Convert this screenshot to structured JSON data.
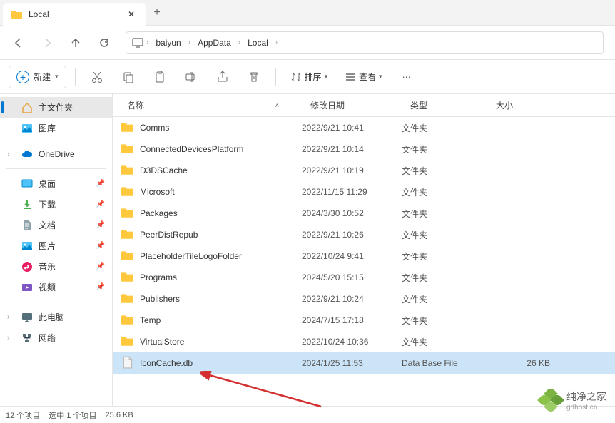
{
  "tab": {
    "title": "Local"
  },
  "breadcrumb": [
    "baiyun",
    "AppData",
    "Local"
  ],
  "toolbar": {
    "new_label": "新建",
    "sort_label": "排序",
    "view_label": "查看"
  },
  "columns": {
    "name": "名称",
    "date": "修改日期",
    "type": "类型",
    "size": "大小"
  },
  "sidebar": {
    "home": "主文件夹",
    "gallery": "图库",
    "onedrive": "OneDrive",
    "desktop": "桌面",
    "downloads": "下载",
    "documents": "文档",
    "pictures": "图片",
    "music": "音乐",
    "videos": "视频",
    "thispc": "此电脑",
    "network": "网络"
  },
  "files": [
    {
      "name": "Comms",
      "date": "2022/9/21 10:41",
      "type": "文件夹",
      "size": "",
      "kind": "folder"
    },
    {
      "name": "ConnectedDevicesPlatform",
      "date": "2022/9/21 10:14",
      "type": "文件夹",
      "size": "",
      "kind": "folder"
    },
    {
      "name": "D3DSCache",
      "date": "2022/9/21 10:19",
      "type": "文件夹",
      "size": "",
      "kind": "folder"
    },
    {
      "name": "Microsoft",
      "date": "2022/11/15 11:29",
      "type": "文件夹",
      "size": "",
      "kind": "folder"
    },
    {
      "name": "Packages",
      "date": "2024/3/30 10:52",
      "type": "文件夹",
      "size": "",
      "kind": "folder"
    },
    {
      "name": "PeerDistRepub",
      "date": "2022/9/21 10:26",
      "type": "文件夹",
      "size": "",
      "kind": "folder"
    },
    {
      "name": "PlaceholderTileLogoFolder",
      "date": "2022/10/24 9:41",
      "type": "文件夹",
      "size": "",
      "kind": "folder"
    },
    {
      "name": "Programs",
      "date": "2024/5/20 15:15",
      "type": "文件夹",
      "size": "",
      "kind": "folder"
    },
    {
      "name": "Publishers",
      "date": "2022/9/21 10:24",
      "type": "文件夹",
      "size": "",
      "kind": "folder"
    },
    {
      "name": "Temp",
      "date": "2024/7/15 17:18",
      "type": "文件夹",
      "size": "",
      "kind": "folder"
    },
    {
      "name": "VirtualStore",
      "date": "2022/10/24 10:36",
      "type": "文件夹",
      "size": "",
      "kind": "folder"
    },
    {
      "name": "IconCache.db",
      "date": "2024/1/25 11:53",
      "type": "Data Base File",
      "size": "26 KB",
      "kind": "file",
      "selected": true
    }
  ],
  "status": {
    "count": "12 个项目",
    "selected": "选中 1 个项目",
    "size": "25.6 KB"
  },
  "watermark": {
    "text": "纯净之家",
    "url": "gdhost.cn"
  }
}
